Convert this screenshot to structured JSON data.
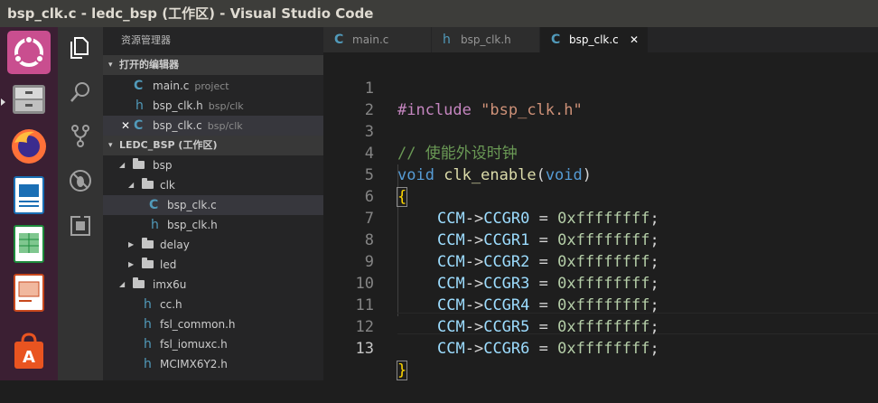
{
  "window": {
    "title": "bsp_clk.c - ledc_bsp (工作区) - Visual Studio Code"
  },
  "launcher": {
    "items": [
      {
        "name": "ubuntu-dash-icon",
        "color": "#e95420"
      },
      {
        "name": "files-icon",
        "color": "#8a8a8a"
      },
      {
        "name": "firefox-icon",
        "color": "#ff7139"
      },
      {
        "name": "writer-icon",
        "color": "#1a6fb5"
      },
      {
        "name": "calc-icon",
        "color": "#1e8b3c"
      },
      {
        "name": "impress-icon",
        "color": "#c8481d"
      },
      {
        "name": "software-center-icon",
        "color": "#e95420"
      }
    ]
  },
  "activity_bar": {
    "icons": [
      "explorer-icon",
      "search-icon",
      "source-control-icon",
      "debug-icon",
      "extensions-icon"
    ]
  },
  "explorer": {
    "title": "资源管理器",
    "open_editors": {
      "label": "打开的编辑器",
      "items": [
        {
          "icon": "C",
          "name": "main.c",
          "desc": "project"
        },
        {
          "icon": "h",
          "name": "bsp_clk.h",
          "desc": "bsp/clk"
        },
        {
          "icon": "C",
          "name": "bsp_clk.c",
          "desc": "bsp/clk",
          "close": "✕"
        }
      ]
    },
    "workspace": {
      "label": "LEDC_BSP (工作区)",
      "tree": [
        {
          "type": "folder",
          "name": "bsp",
          "expanded": true
        },
        {
          "type": "folder",
          "name": "clk",
          "expanded": true
        },
        {
          "type": "c",
          "name": "bsp_clk.c",
          "icon": "C"
        },
        {
          "type": "h",
          "name": "bsp_clk.h",
          "icon": "h"
        },
        {
          "type": "folder",
          "name": "delay",
          "expanded": false
        },
        {
          "type": "folder",
          "name": "led",
          "expanded": false
        },
        {
          "type": "folder",
          "name": "imx6u",
          "expanded": true
        },
        {
          "type": "h",
          "name": "cc.h",
          "icon": "h"
        },
        {
          "type": "h",
          "name": "fsl_common.h",
          "icon": "h"
        },
        {
          "type": "h",
          "name": "fsl_iomuxc.h",
          "icon": "h"
        },
        {
          "type": "h",
          "name": "MCIMX6Y2.h",
          "icon": "h"
        }
      ]
    }
  },
  "tabs": [
    {
      "icon": "C",
      "label": "main.c"
    },
    {
      "icon": "h",
      "label": "bsp_clk.h"
    },
    {
      "icon": "C",
      "label": "bsp_clk.c",
      "close": "✕"
    }
  ],
  "code": {
    "line_numbers": [
      "1",
      "2",
      "3",
      "4",
      "5",
      "6",
      "7",
      "8",
      "9",
      "10",
      "11",
      "12",
      "13"
    ],
    "line1": {
      "directive": "#include",
      "path": "\"bsp_clk.h\""
    },
    "line3": {
      "comment": "// 使能外设时钟"
    },
    "line4": {
      "ret": "void",
      "fn": "clk_enable",
      "open": "(",
      "param": "void",
      "close": ")"
    },
    "line5": {
      "brace": "{"
    },
    "assignments": [
      {
        "obj": "CCM",
        "arrow": "->",
        "field": "CCGR0",
        "eq": " = ",
        "value": "0xffffffff",
        "semi": ";"
      },
      {
        "obj": "CCM",
        "arrow": "->",
        "field": "CCGR1",
        "eq": " = ",
        "value": "0xffffffff",
        "semi": ";"
      },
      {
        "obj": "CCM",
        "arrow": "->",
        "field": "CCGR2",
        "eq": " = ",
        "value": "0xffffffff",
        "semi": ";"
      },
      {
        "obj": "CCM",
        "arrow": "->",
        "field": "CCGR3",
        "eq": " = ",
        "value": "0xffffffff",
        "semi": ";"
      },
      {
        "obj": "CCM",
        "arrow": "->",
        "field": "CCGR4",
        "eq": " = ",
        "value": "0xffffffff",
        "semi": ";"
      },
      {
        "obj": "CCM",
        "arrow": "->",
        "field": "CCGR5",
        "eq": " = ",
        "value": "0xffffffff",
        "semi": ";"
      },
      {
        "obj": "CCM",
        "arrow": "->",
        "field": "CCGR6",
        "eq": " = ",
        "value": "0xffffffff",
        "semi": ";"
      }
    ],
    "line13": {
      "brace": "}"
    }
  }
}
